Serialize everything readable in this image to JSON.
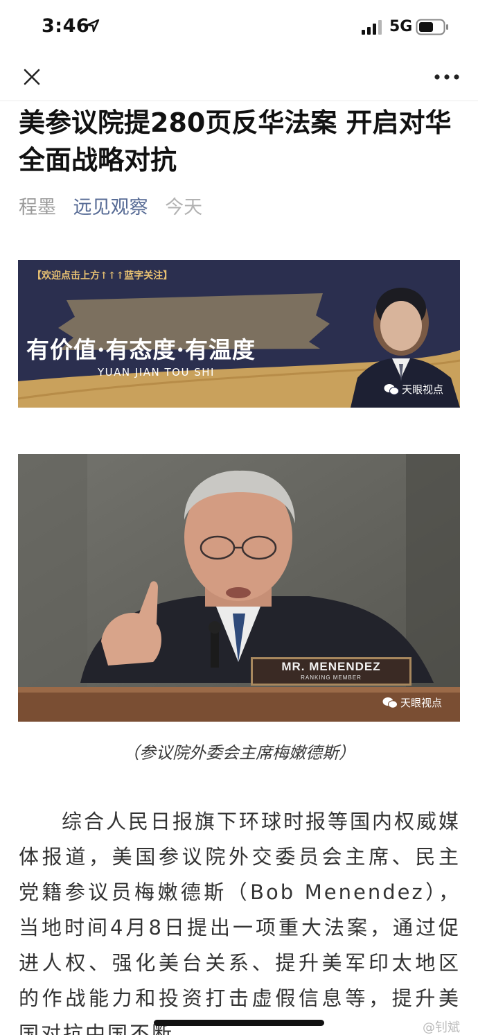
{
  "status_bar": {
    "time": "3:46",
    "network": "5G"
  },
  "article": {
    "title": "美参议院提280页反华法案 开启对华全面战略对抗",
    "author": "程墨",
    "account": "远见观察",
    "date": "今天"
  },
  "banner": {
    "notice": "【欢迎点击上方↑↑↑蓝字关注】",
    "slogan": "有价值·有态度·有温度",
    "subtitle": "YUAN JIAN TOU SHI",
    "watermark": "天眼视点"
  },
  "photo": {
    "nameplate_name": "MR. MENENDEZ",
    "nameplate_sub": "RANKING MEMBER",
    "watermark": "天眼视点"
  },
  "caption": "（参议院外委会主席梅嫩德斯）",
  "body_text": "综合人民日报旗下环球时报等国内权威媒体报道，美国参议院外交委员会主席、民主党籍参议员梅嫩德斯（Bob Menendez），当地时间4月8日提出一项重大法案，通过促进人权、强化美台关系、提升美军印太地区的作战能力和投资打击虚假信息等，提升美国对抗中国不断",
  "corner_watermark": "@钊斌",
  "colors": {
    "link": "#576b95",
    "banner_bg": "#2b2f4f",
    "banner_gold": "#c9a15c"
  },
  "icons": [
    "location-arrow-icon",
    "signal-icon",
    "battery-icon",
    "close-icon",
    "more-icon",
    "wechat-icon"
  ]
}
